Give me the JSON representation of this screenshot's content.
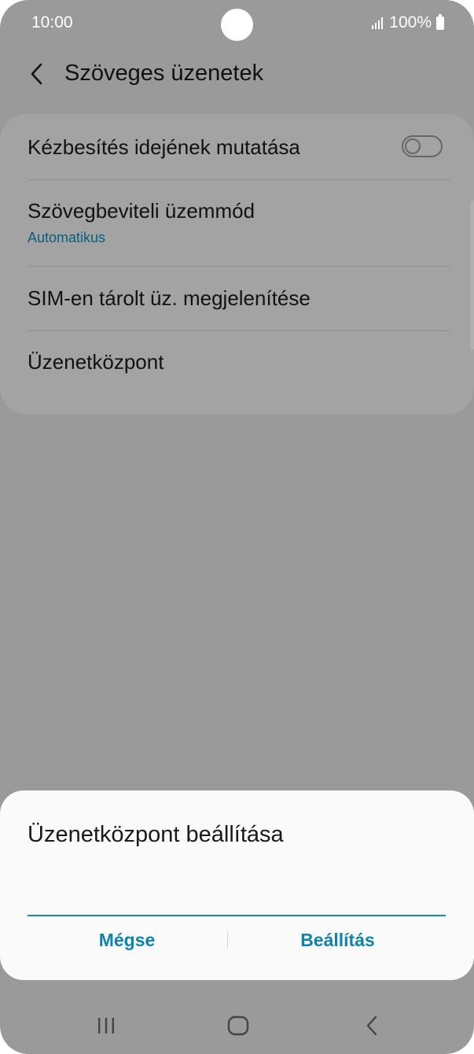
{
  "status_bar": {
    "time": "10:00",
    "battery_text": "100%",
    "icons": [
      "signal-icon",
      "battery-icon"
    ]
  },
  "app_bar": {
    "title": "Szöveges üzenetek",
    "back_icon": "back-arrow-icon"
  },
  "settings": {
    "items": [
      {
        "label": "Kézbesítés idejének mutatása",
        "toggle_on": false
      },
      {
        "label": "Szövegbeviteli üzemmód",
        "sublabel": "Automatikus"
      },
      {
        "label": "SIM-en tárolt üz. megjelenítése"
      },
      {
        "label": "Üzenetközpont"
      }
    ]
  },
  "dialog": {
    "title": "Üzenetközpont beállítása",
    "input_value": "",
    "cancel_label": "Mégse",
    "confirm_label": "Beállítás"
  },
  "nav_bar": {
    "icons": [
      "recent-apps-icon",
      "home-icon",
      "back-icon"
    ]
  },
  "colors": {
    "accent": "#0e83ad",
    "sublabel": "#0a5f80",
    "scrim": "#9a9a9a",
    "dialog_bg": "#fafafa"
  }
}
